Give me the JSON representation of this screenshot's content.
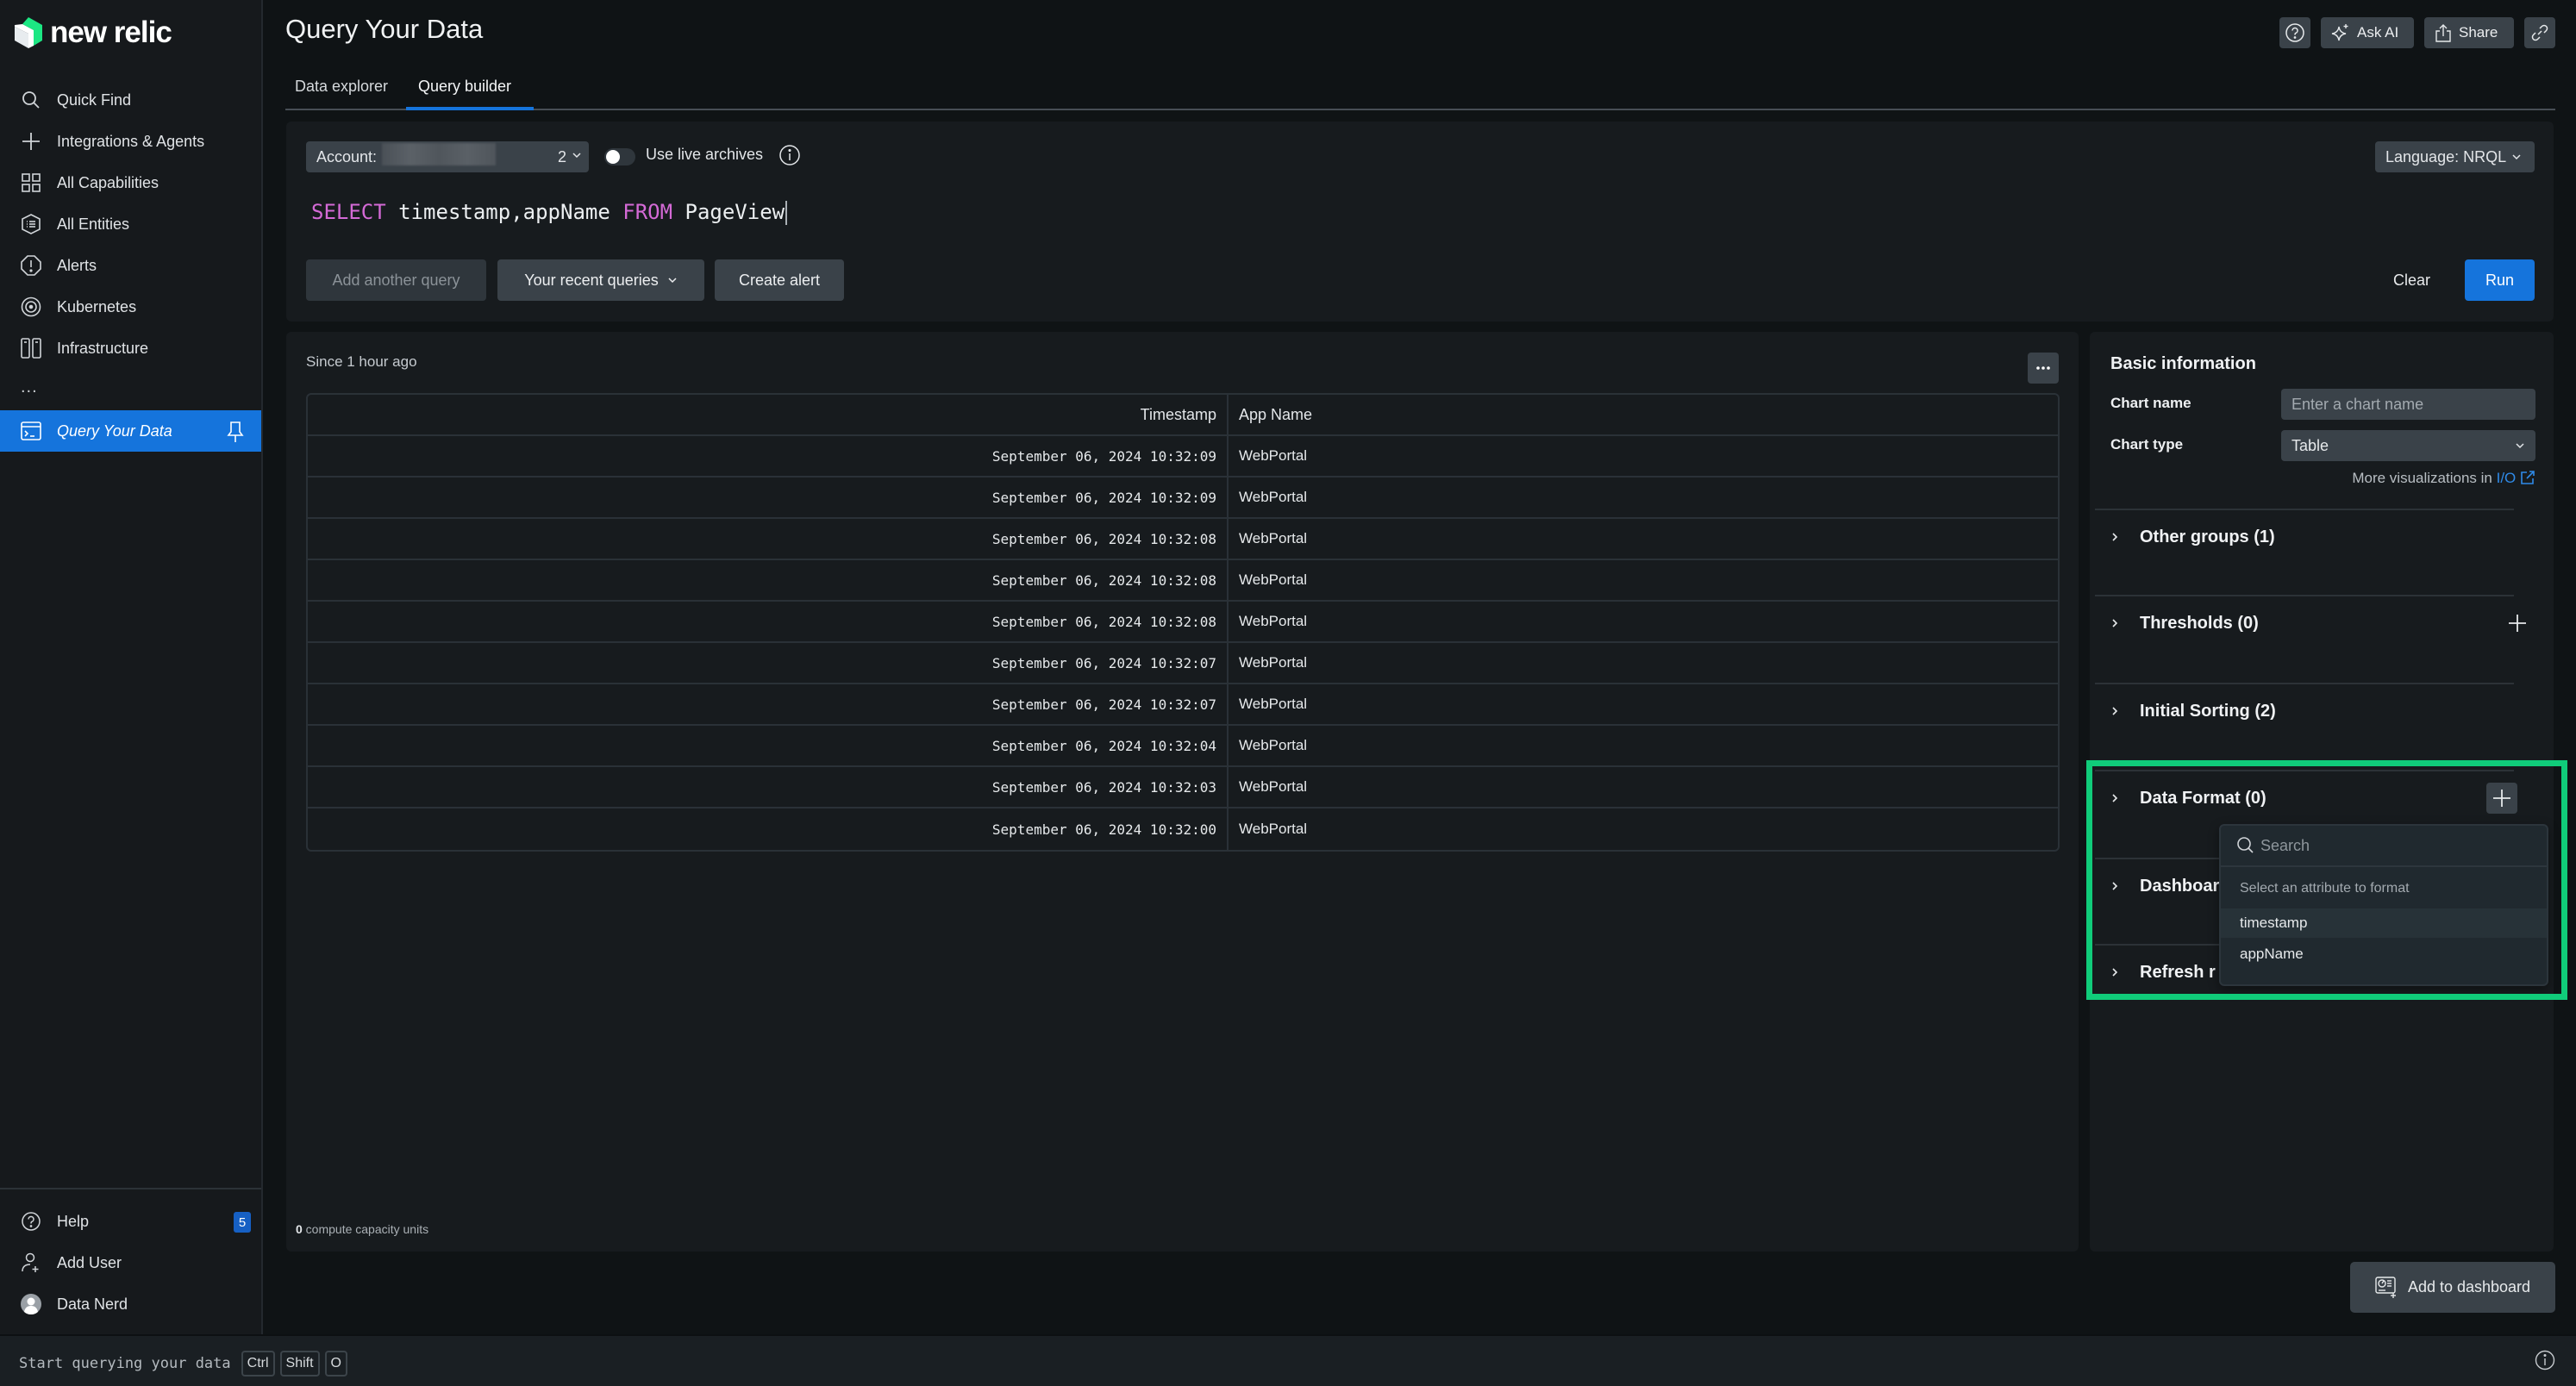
{
  "brand": {
    "name": "new relic",
    "accent": "#1ce783"
  },
  "sidebar": {
    "items": [
      {
        "label": "Quick Find",
        "icon": "search-icon"
      },
      {
        "label": "Integrations & Agents",
        "icon": "plus-icon"
      },
      {
        "label": "All Capabilities",
        "icon": "grid-icon"
      },
      {
        "label": "All Entities",
        "icon": "entities-hex-icon"
      },
      {
        "label": "Alerts",
        "icon": "alert-icon"
      },
      {
        "label": "Kubernetes",
        "icon": "kubernetes-icon"
      },
      {
        "label": "Infrastructure",
        "icon": "infrastructure-icon"
      }
    ],
    "more": "...",
    "active_item": {
      "label": "Query Your Data",
      "icon": "terminal-icon",
      "pin_icon": "pin-icon"
    },
    "bottom_items": [
      {
        "label": "Help",
        "icon": "help-icon",
        "badge": "5"
      },
      {
        "label": "Add User",
        "icon": "add-user-icon"
      },
      {
        "label": "Data Nerd",
        "icon": "avatar"
      }
    ]
  },
  "header": {
    "title": "Query Your Data",
    "tabs": [
      {
        "label": "Data explorer",
        "active": false
      },
      {
        "label": "Query builder",
        "active": true
      }
    ],
    "actions": {
      "help_icon": "help-icon",
      "ask_ai": "Ask AI",
      "share": "Share",
      "link_icon": "link-icon"
    }
  },
  "query": {
    "account_label": "Account:",
    "account_suffix": "2",
    "live_archives_label": "Use live archives",
    "live_archives_on": false,
    "language": "Language: NRQL",
    "nrql": {
      "kw_select": "SELECT",
      "fields": " timestamp,appName ",
      "kw_from": "FROM",
      "source": " PageView"
    },
    "add_another": "Add another query",
    "recent": "Your recent queries",
    "create_alert": "Create alert",
    "clear": "Clear",
    "run": "Run"
  },
  "results": {
    "since": "Since 1 hour ago",
    "columns": [
      "Timestamp",
      "App Name"
    ],
    "rows": [
      [
        "September 06, 2024 10:32:09",
        "WebPortal"
      ],
      [
        "September 06, 2024 10:32:09",
        "WebPortal"
      ],
      [
        "September 06, 2024 10:32:08",
        "WebPortal"
      ],
      [
        "September 06, 2024 10:32:08",
        "WebPortal"
      ],
      [
        "September 06, 2024 10:32:08",
        "WebPortal"
      ],
      [
        "September 06, 2024 10:32:07",
        "WebPortal"
      ],
      [
        "September 06, 2024 10:32:07",
        "WebPortal"
      ],
      [
        "September 06, 2024 10:32:04",
        "WebPortal"
      ],
      [
        "September 06, 2024 10:32:03",
        "WebPortal"
      ],
      [
        "September 06, 2024 10:32:00",
        "WebPortal"
      ]
    ],
    "ccu_value": "0",
    "ccu_label": " compute capacity units"
  },
  "config": {
    "basic_title": "Basic information",
    "chart_name_label": "Chart name",
    "chart_name_placeholder": "Enter a chart name",
    "chart_name_value": "",
    "chart_type_label": "Chart type",
    "chart_type_value": "Table",
    "more_viz_prefix": "More visualizations in ",
    "more_viz_link": "I/O",
    "sections": [
      {
        "label": "Other groups (1)",
        "has_add": false
      },
      {
        "label": "Thresholds (0)",
        "has_add": true
      },
      {
        "label": "Initial Sorting (2)",
        "has_add": false
      },
      {
        "label": "Data Format (0)",
        "has_add": true
      },
      {
        "label": "Dashboard",
        "has_add": false
      },
      {
        "label": "Refresh r",
        "has_add": false
      }
    ]
  },
  "attr_dropdown": {
    "search_placeholder": "Search",
    "search_value": "",
    "hint": "Select an attribute to format",
    "options": [
      "timestamp",
      "appName"
    ],
    "hovered": "timestamp"
  },
  "footer": {
    "add_to_dashboard": "Add to dashboard",
    "hint": "Start querying your data",
    "keys": [
      "Ctrl",
      "Shift",
      "O"
    ]
  },
  "colors": {
    "primary": "#1574dc",
    "keyword": "#d46ad6",
    "highlight": "#10cc7a",
    "link": "#2f8ae8"
  }
}
